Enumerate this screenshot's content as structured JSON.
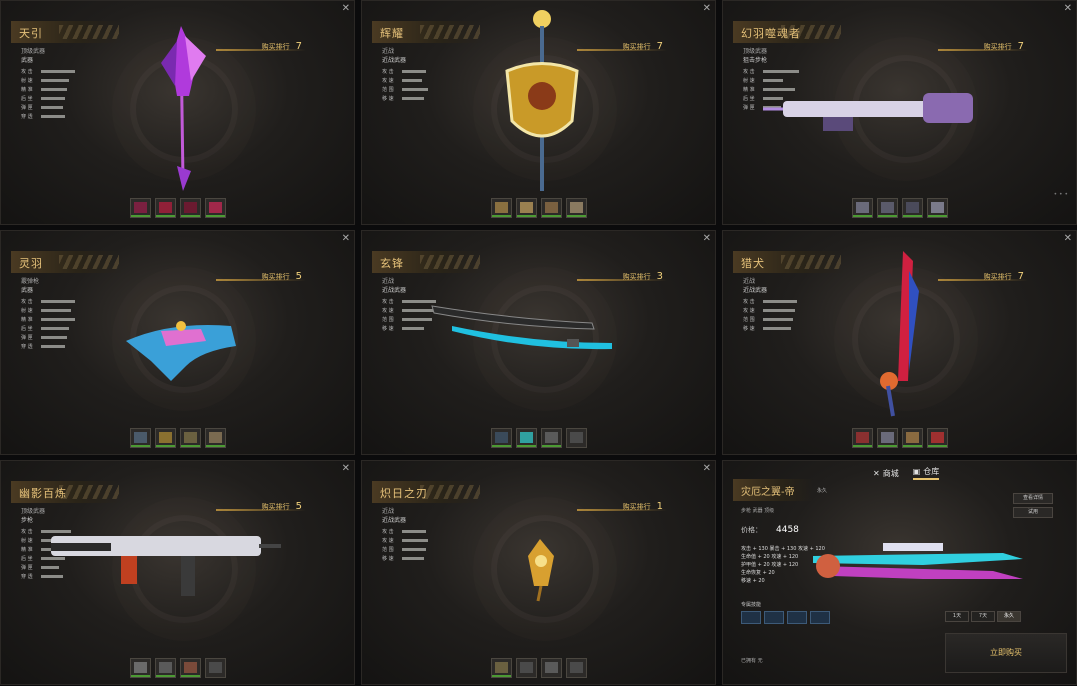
{
  "panels": [
    {
      "title": "天引",
      "subtitle": "武器",
      "tag": "顶级武器",
      "rank_label": "购买排行",
      "rank": "7",
      "stats": [
        {
          "label": "攻 击",
          "value": 0.85
        },
        {
          "label": "射 速",
          "value": 0.7
        },
        {
          "label": "精 准",
          "value": 0.65
        },
        {
          "label": "后 坐",
          "value": 0.6
        },
        {
          "label": "弹 匣",
          "value": 0.55
        },
        {
          "label": "穿 透",
          "value": 0.6
        }
      ]
    },
    {
      "title": "辉耀",
      "subtitle": "近战武器",
      "tag": "近战",
      "rank_label": "购买排行",
      "rank": "7",
      "stats": [
        {
          "label": "攻 击",
          "value": 0.6
        },
        {
          "label": "攻 速",
          "value": 0.5
        },
        {
          "label": "范 围",
          "value": 0.65
        },
        {
          "label": "移 速",
          "value": 0.55
        }
      ]
    },
    {
      "title": "幻羽噬魂者",
      "subtitle": "狙击步枪",
      "tag": "顶级武器",
      "rank_label": "购买排行",
      "rank": "7",
      "stats": [
        {
          "label": "攻 击",
          "value": 0.9
        },
        {
          "label": "射 速",
          "value": 0.5
        },
        {
          "label": "精 准",
          "value": 0.8
        },
        {
          "label": "后 坐",
          "value": 0.5
        },
        {
          "label": "弹 匣",
          "value": 0.45
        }
      ]
    },
    {
      "title": "灵羽",
      "subtitle": "武器",
      "tag": "霰弹枪",
      "rank_label": "购买排行",
      "rank": "5",
      "stats": [
        {
          "label": "攻 击",
          "value": 0.85
        },
        {
          "label": "射 速",
          "value": 0.75
        },
        {
          "label": "精 准",
          "value": 0.85
        },
        {
          "label": "后 坐",
          "value": 0.7
        },
        {
          "label": "弹 匣",
          "value": 0.65
        },
        {
          "label": "穿 透",
          "value": 0.6
        }
      ]
    },
    {
      "title": "玄锋",
      "subtitle": "近战武器",
      "tag": "近战",
      "rank_label": "购买排行",
      "rank": "3",
      "stats": [
        {
          "label": "攻 击",
          "value": 0.85
        },
        {
          "label": "攻 速",
          "value": 0.8
        },
        {
          "label": "范 围",
          "value": 0.75
        },
        {
          "label": "移 速",
          "value": 0.55
        }
      ]
    },
    {
      "title": "猎犬",
      "subtitle": "近战武器",
      "tag": "近战",
      "rank_label": "购买排行",
      "rank": "7",
      "stats": [
        {
          "label": "攻 击",
          "value": 0.85
        },
        {
          "label": "攻 速",
          "value": 0.8
        },
        {
          "label": "范 围",
          "value": 0.75
        },
        {
          "label": "移 速",
          "value": 0.7
        }
      ]
    },
    {
      "title": "幽影百炼",
      "subtitle": "步枪",
      "tag": "顶级武器",
      "rank_label": "购买排行",
      "rank": "5",
      "stats": [
        {
          "label": "攻 击",
          "value": 0.75
        },
        {
          "label": "射 速",
          "value": 0.7
        },
        {
          "label": "精 准",
          "value": 0.75
        },
        {
          "label": "后 坐",
          "value": 0.6
        },
        {
          "label": "弹 匣",
          "value": 0.45
        },
        {
          "label": "穿 透",
          "value": 0.55
        }
      ]
    },
    {
      "title": "炽日之刃",
      "subtitle": "近战武器",
      "tag": "近战",
      "rank_label": "购买排行",
      "rank": "1",
      "stats": [
        {
          "label": "攻 击",
          "value": 0.6
        },
        {
          "label": "攻 速",
          "value": 0.65
        },
        {
          "label": "范 围",
          "value": 0.6
        },
        {
          "label": "移 速",
          "value": 0.55
        }
      ]
    }
  ],
  "detail": {
    "tabs": [
      {
        "icon": "close-icon",
        "label": "商城"
      },
      {
        "icon": "backpack-icon",
        "label": "仓库"
      }
    ],
    "title": "灾厄之翼-帝",
    "tag": "永久",
    "buttons": [
      "查看详情",
      "试用"
    ],
    "meta": "步枪  武器  顶级",
    "price_label": "价格：",
    "price_value": "4458",
    "attrs": [
      "攻击 + 130   暴击 + 130   攻速 + 120",
      "生命值 + 20     攻速 + 120",
      "护甲值 + 20     攻速 + 120",
      "生命恢复 + 20",
      "移速 + 20"
    ],
    "skills_label": "专属技能",
    "segments": [
      "1天",
      "7天",
      "永久"
    ],
    "buy_label": "立即购买",
    "owner_label": "已拥有",
    "owner_value": "无"
  },
  "colors": {
    "gold": "#e6c27a",
    "panel_bg": "#201e1c",
    "accent_green": "#4c9a34"
  }
}
